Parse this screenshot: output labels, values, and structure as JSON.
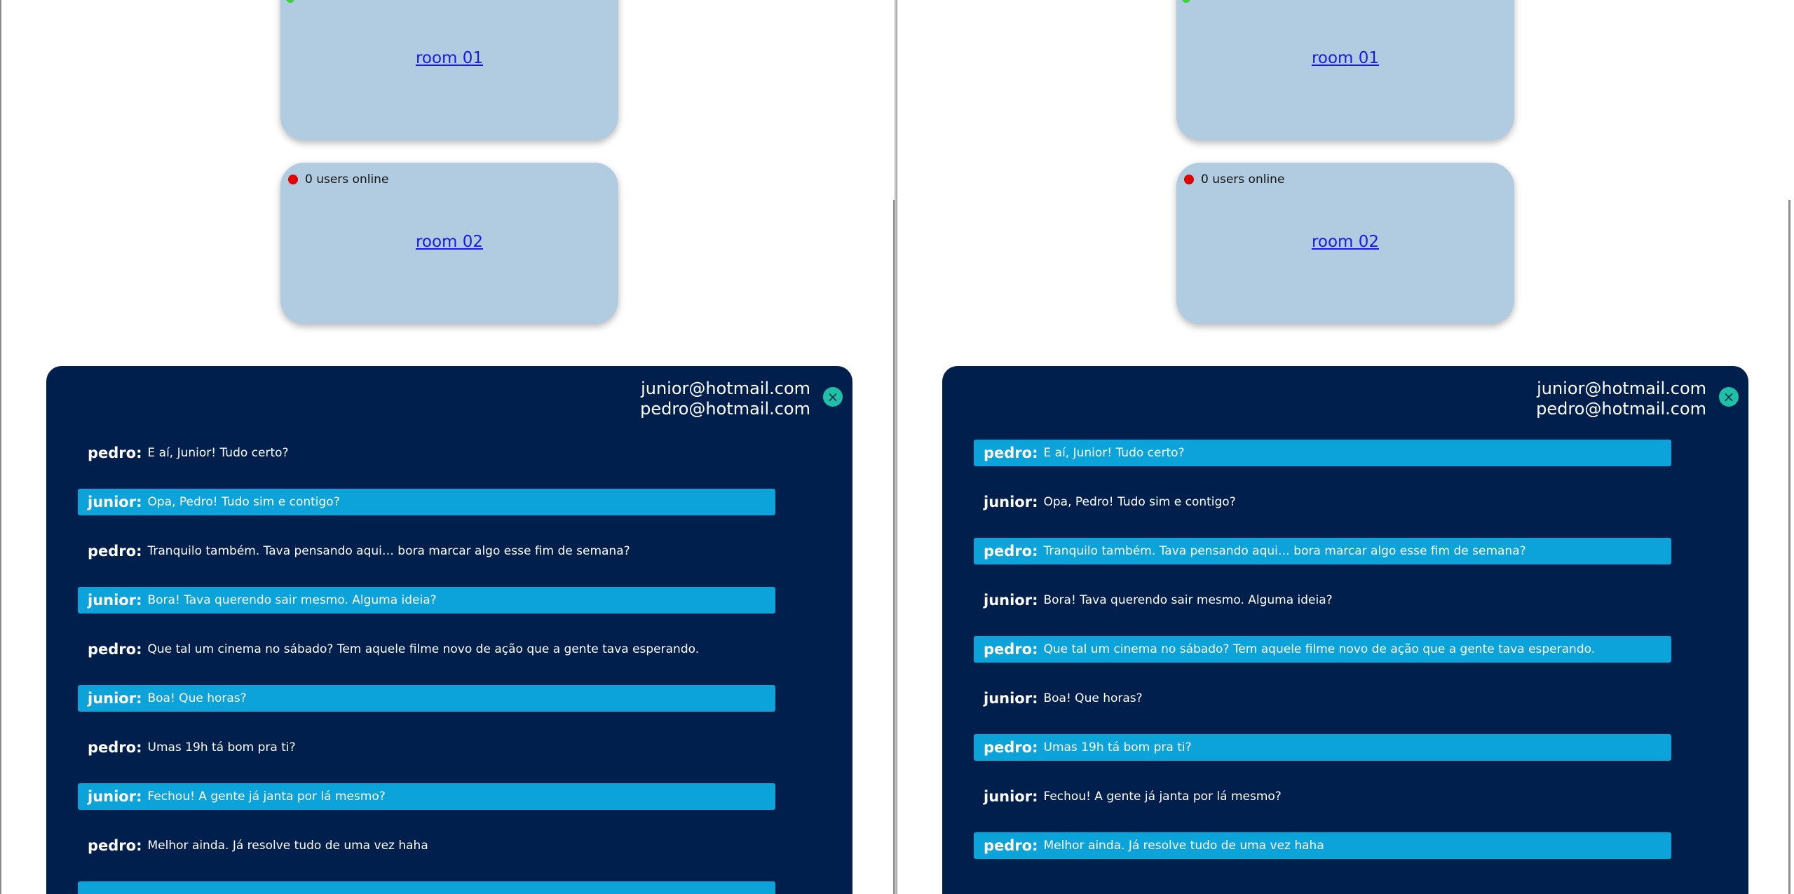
{
  "rooms": [
    {
      "name": "room 01",
      "status": ""
    },
    {
      "name": "room 02",
      "status": "0 users online"
    }
  ],
  "chat": {
    "participants": [
      "junior@hotmail.com",
      "pedro@hotmail.com"
    ],
    "close_icon": "×",
    "messages": [
      {
        "author": "pedro:",
        "text": "E aí, Junior! Tudo certo?"
      },
      {
        "author": "junior:",
        "text": "Opa, Pedro! Tudo sim e contigo?"
      },
      {
        "author": "pedro:",
        "text": "Tranquilo também. Tava pensando aqui… bora marcar algo esse fim de semana?"
      },
      {
        "author": "junior:",
        "text": "Bora! Tava querendo sair mesmo. Alguma ideia?"
      },
      {
        "author": "pedro:",
        "text": "Que tal um cinema no sábado? Tem aquele filme novo de ação que a gente tava esperando."
      },
      {
        "author": "junior:",
        "text": "Boa! Que horas?"
      },
      {
        "author": "pedro:",
        "text": "Umas 19h tá bom pra ti?"
      },
      {
        "author": "junior:",
        "text": "Fechou! A gente já janta por lá mesmo?"
      },
      {
        "author": "pedro:",
        "text": "Melhor ainda. Já resolve tudo de uma vez haha"
      }
    ]
  },
  "colors": {
    "chat_background": "#001f4d",
    "highlight": "#0ca2da",
    "room_card": "#b1cbe0",
    "offline_dot": "#e00000"
  }
}
